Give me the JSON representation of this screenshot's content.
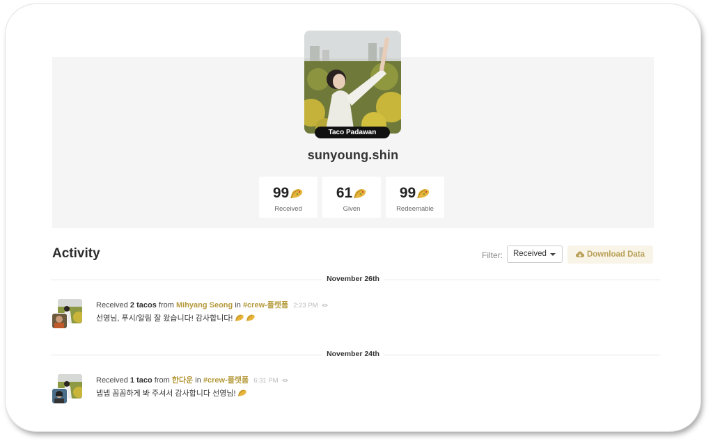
{
  "profile": {
    "rank": "Taco Padawan",
    "username": "sunyoung.shin",
    "stats": [
      {
        "value": "99",
        "label": "Received"
      },
      {
        "value": "61",
        "label": "Given"
      },
      {
        "value": "99",
        "label": "Redeemable"
      }
    ]
  },
  "activity": {
    "title": "Activity",
    "filter_label": "Filter:",
    "filter_value": "Received",
    "download_label": "Download Data"
  },
  "feed": [
    {
      "date": "November 26th",
      "prefix": "Received",
      "amount": "2 tacos",
      "from_word": "from",
      "sender": "Mihyang Seong",
      "in_word": "in",
      "channel": "#crew-플랫폼",
      "time": "2:23 PM",
      "message": "선영님, 푸시/알림 잘 왔습니다! 감사합니다!",
      "taco_count": 2
    },
    {
      "date": "November 24th",
      "prefix": "Received",
      "amount": "1 taco",
      "from_word": "from",
      "sender": "한다운",
      "in_word": "in",
      "channel": "#crew-플랫폼",
      "time": "6:31 PM",
      "message": "넵넵 꼼꼼하게 봐 주셔서 감사합니다 선영님!",
      "taco_count": 1
    }
  ],
  "colors": {
    "accent": "#b59a3c",
    "hero_bg": "#f5f5f5",
    "badge_bg": "#111111"
  },
  "icons": {
    "taco": "taco-icon",
    "download": "cloud-download-icon",
    "seen": "eye-icon",
    "dropdown": "caret-down-icon"
  }
}
